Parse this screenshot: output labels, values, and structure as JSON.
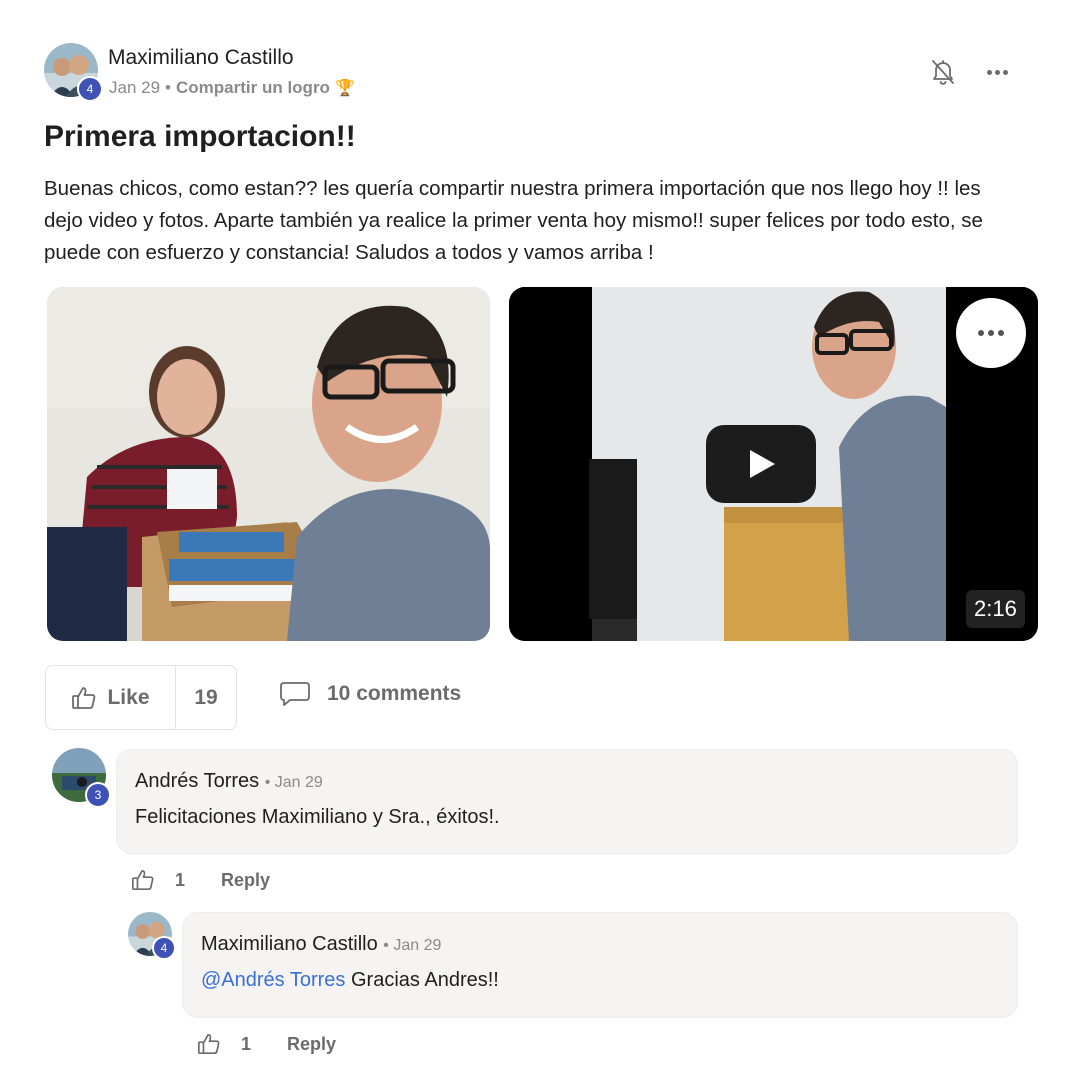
{
  "post": {
    "author": "Maximiliano Castillo",
    "author_level": "4",
    "date": "Jan 29",
    "separator": "•",
    "category": "Compartir un logro",
    "category_icon": "🏆",
    "title": "Primera importacion!!",
    "body": "Buenas chicos, como estan?? les quería compartir nuestra primera importación que nos llego hoy !! les dejo video y fotos. Aparte también ya realice la primer venta hoy mismo!! super felices por todo esto, se puede con esfuerzo y constancia! Saludos a todos y vamos arriba !",
    "video_duration": "2:16",
    "like_label": "Like",
    "like_count": "19",
    "comments_label": "10 comments"
  },
  "comments": [
    {
      "author": "Andrés Torres",
      "level": "3",
      "date": "• Jan 29",
      "text": "Felicitaciones Maximiliano y Sra., éxitos!.",
      "likes": "1",
      "reply_label": "Reply"
    }
  ],
  "replies": [
    {
      "author": "Maximiliano Castillo",
      "level": "4",
      "date": "• Jan 29",
      "mention": "@Andrés Torres",
      "text": " Gracias Andres!!",
      "likes": "1",
      "reply_label": "Reply"
    }
  ],
  "icons": {
    "bell": "bell-off-icon",
    "more": "more-horizontal-icon",
    "like": "thumbs-up-icon",
    "comment": "comment-bubble-icon",
    "play": "play-icon"
  },
  "colors": {
    "badge": "#3f51b5",
    "mention": "#3a6fd8",
    "muted": "#6b6b6b"
  }
}
